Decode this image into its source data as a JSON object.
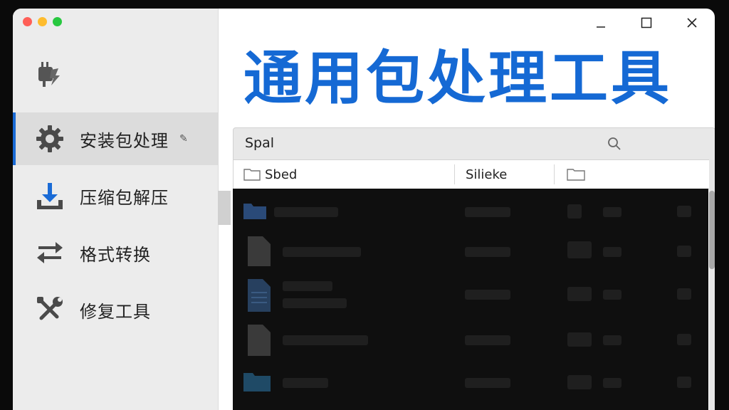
{
  "window": {
    "traffic_lights": {
      "close": "#ff5f57",
      "minimize": "#febc2e",
      "zoom": "#28c840"
    }
  },
  "app": {
    "title": "通用包处理工具"
  },
  "sidebar": {
    "items": [
      {
        "label": "安装包处理",
        "icon": "gear-icon",
        "active": true
      },
      {
        "label": "压缩包解压",
        "icon": "download-icon",
        "active": false
      },
      {
        "label": "格式转换",
        "icon": "swap-arrows-icon",
        "active": false
      },
      {
        "label": "修复工具",
        "icon": "wrench-screwdriver-icon",
        "active": false
      }
    ]
  },
  "search": {
    "value": "Spal"
  },
  "table": {
    "columns": [
      "Sbed",
      "Silieke",
      ""
    ]
  },
  "colors": {
    "accent": "#1569d4",
    "sidebar_bg": "#ececec",
    "list_bg": "#0f0f0f"
  }
}
